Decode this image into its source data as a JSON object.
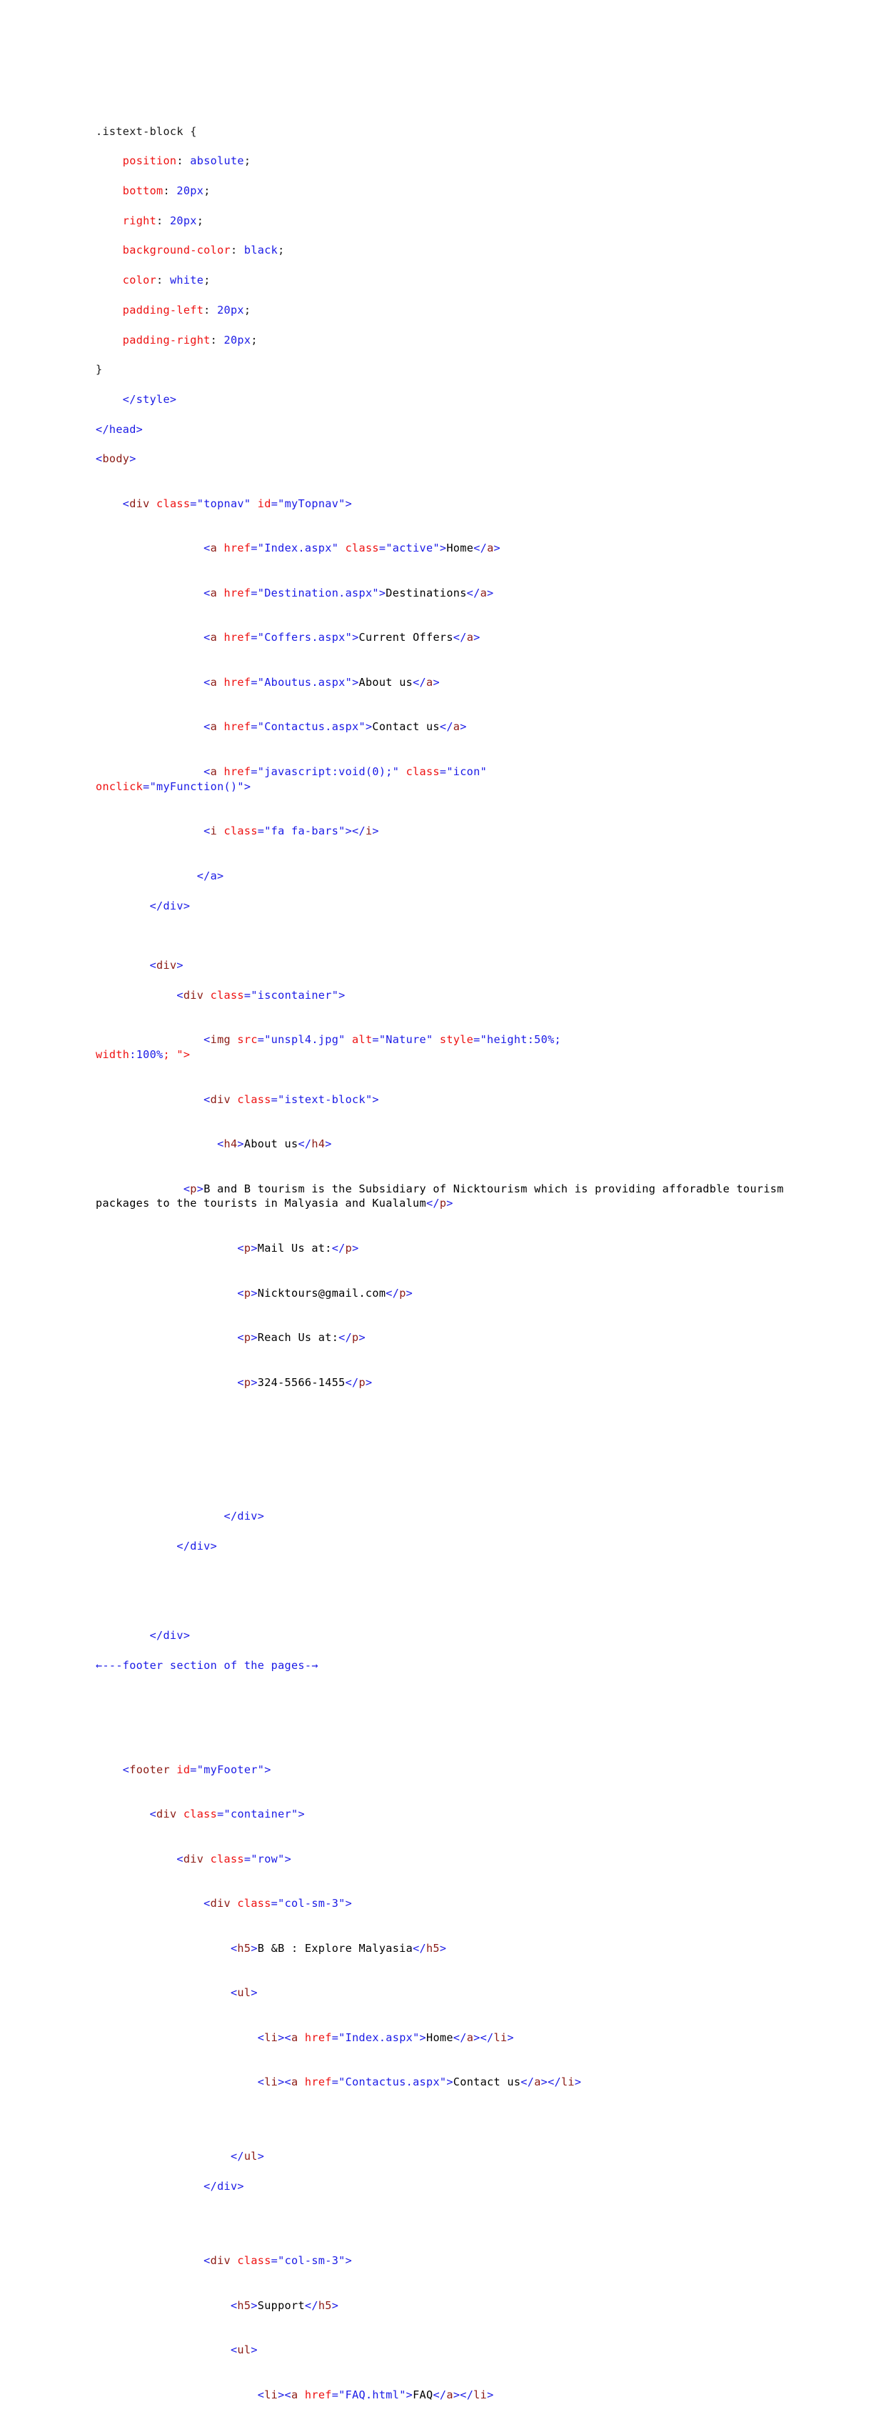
{
  "document": {
    "kind": "html-source-listing",
    "colors": {
      "background": "#ffffff",
      "tag_name": "#8b1a14",
      "punctuation": "#1a1ae6",
      "attribute_name": "#ee1111",
      "attribute_value": "#1a1ae6",
      "text_node": "#000000",
      "css_property": "#ee1111",
      "css_value": "#1a1ae6",
      "comment": "#1a1ae6"
    }
  },
  "lines": {
    "l01": ".istext-block {",
    "l02_prop": "position",
    "l02_val": "absolute",
    "l03_prop": "bottom",
    "l03_val": "20px",
    "l04_prop": "right",
    "l04_val": "20px",
    "l05_prop": "background-color",
    "l05_val": "black",
    "l06_prop": "color",
    "l06_val": "white",
    "l07_prop": "padding-left",
    "l07_val": "20px",
    "l08_prop": "padding-right",
    "l08_val": "20px",
    "l09": "}",
    "l10": "</style>",
    "l11": "</head>",
    "l12_tag": "body",
    "l13_tag": "div",
    "l13_att1": "class",
    "l13_val1": "\"topnav\"",
    "l13_att2": "id",
    "l13_val2": "\"myTopnav\"",
    "nav": [
      {
        "tag": "a",
        "att1": "href",
        "val1": "\"Index.aspx\"",
        "att2": "class",
        "val2": "\"active\"",
        "text": "Home"
      },
      {
        "tag": "a",
        "att1": "href",
        "val1": "\"Destination.aspx\"",
        "att2": "",
        "val2": "",
        "text": "Destinations"
      },
      {
        "tag": "a",
        "att1": "href",
        "val1": "\"Coffers.aspx\"",
        "att2": "",
        "val2": "",
        "text": "Current Offers"
      },
      {
        "tag": "a",
        "att1": "href",
        "val1": "\"Aboutus.aspx\"",
        "att2": "",
        "val2": "",
        "text": "About us"
      },
      {
        "tag": "a",
        "att1": "href",
        "val1": "\"Contactus.aspx\"",
        "att2": "",
        "val2": "",
        "text": "Contact us"
      }
    ],
    "icon_link": {
      "tag": "a",
      "att1": "href",
      "val1": "\"javascript:void(0);\"",
      "att2": "class",
      "val2": "\"icon\"",
      "att3": "onclick",
      "val3": "\"myFunction()\""
    },
    "icon_i": {
      "tag": "i",
      "att": "class",
      "val": "\"fa fa-bars\""
    },
    "close_a": "</a>",
    "close_div_1": "</div>",
    "plain_div": "div",
    "iscontainer_att": "class",
    "iscontainer_val": "\"iscontainer\"",
    "img": {
      "tag": "img",
      "att1": "src",
      "val1": "\"unspl4.jpg\"",
      "att2": "alt",
      "val2": "\"Nature\"",
      "att3": "style",
      "val3": "\"height:50%;",
      "style_cont_prop": "width",
      "style_cont_val": "100%",
      "style_tail": "; \">"
    },
    "istext_att": "class",
    "istext_val": "\"istext-block\"",
    "h4_tag": "h4",
    "h4_text": "About us",
    "p_about_tag": "p",
    "p_about_text": "B and B tourism is the Subsidiary of Nicktourism which is providing afforadble tourism packages to the tourists in Malyasia and Kualalum",
    "p_mail_label": "Mail Us at:",
    "p_mail_value": "Nicktours@gmail.com",
    "p_reach_label": "Reach Us at:",
    "p_reach_value": "324-5566-1455",
    "comment_footer": "←---footer section of the pages-→",
    "footer_tag": "footer",
    "footer_att": "id",
    "footer_val": "\"myFooter\"",
    "container_att": "class",
    "container_val": "\"container\"",
    "row_att": "class",
    "row_val": "\"row\"",
    "colsm3_att": "class",
    "colsm3_val": "\"col-sm-3\"",
    "h5_tag": "h5",
    "h5_text_1": "B &B : Explore Malyasia",
    "h5_text_2": "Support",
    "ul_tag": "ul",
    "li_tag": "li",
    "footer_links_1": [
      {
        "att": "href",
        "val": "\"Index.aspx\"",
        "text": "Home"
      },
      {
        "att": "href",
        "val": "\"Contactus.aspx\"",
        "text": "Contact us"
      }
    ],
    "footer_links_2": [
      {
        "att": "href",
        "val": "\"FAQ.html\"",
        "text": "FAQ"
      }
    ]
  }
}
